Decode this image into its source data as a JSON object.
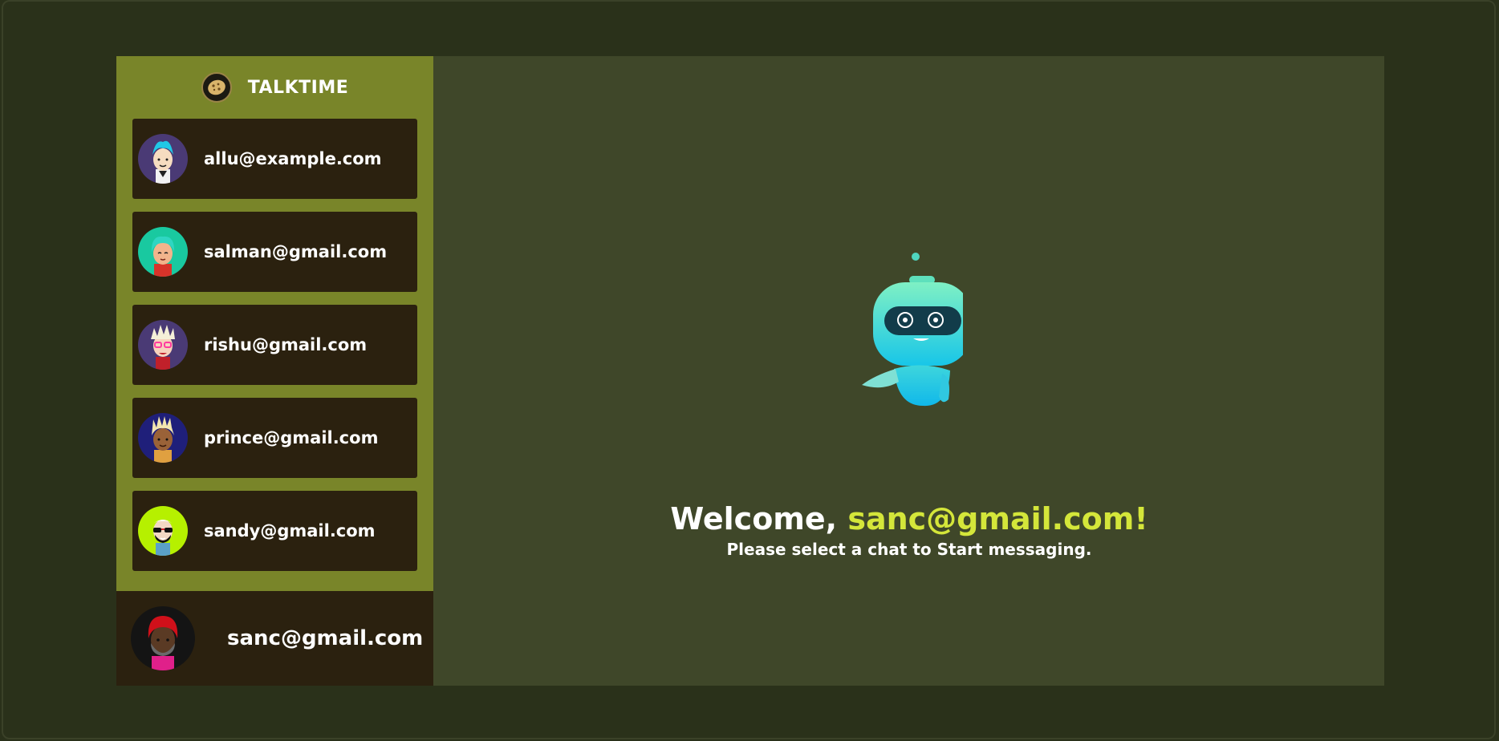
{
  "brand": {
    "title": "TALKTIME",
    "logo_icon": "cookie-logo-icon"
  },
  "contacts": [
    {
      "email": "allu@example.com",
      "avatar": "avatar-blue-hair",
      "avatar_bg": "#4a3a75"
    },
    {
      "email": "salman@gmail.com",
      "avatar": "avatar-teal-hair",
      "avatar_bg": "#19c9a0"
    },
    {
      "email": "rishu@gmail.com",
      "avatar": "avatar-pink-glasses",
      "avatar_bg": "#4a3a75"
    },
    {
      "email": "prince@gmail.com",
      "avatar": "avatar-dreadlocks",
      "avatar_bg": "#1f1f7a"
    },
    {
      "email": "sandy@gmail.com",
      "avatar": "avatar-sunglasses",
      "avatar_bg": "#b6f000"
    }
  ],
  "current_user": {
    "email": "sanc@gmail.com",
    "avatar": "avatar-red-hair",
    "avatar_bg": "#141414"
  },
  "welcome": {
    "greeting": "Welcome, ",
    "email": "sanc@gmail.com!",
    "subtitle": "Please select a chat to Start messaging.",
    "illustration": "robot-icon"
  },
  "colors": {
    "page_bg": "#2a311a",
    "sidebar_bg": "#798529",
    "card_bg": "#2b210f",
    "main_bg": "#3f4729",
    "accent": "#d4e63a"
  }
}
